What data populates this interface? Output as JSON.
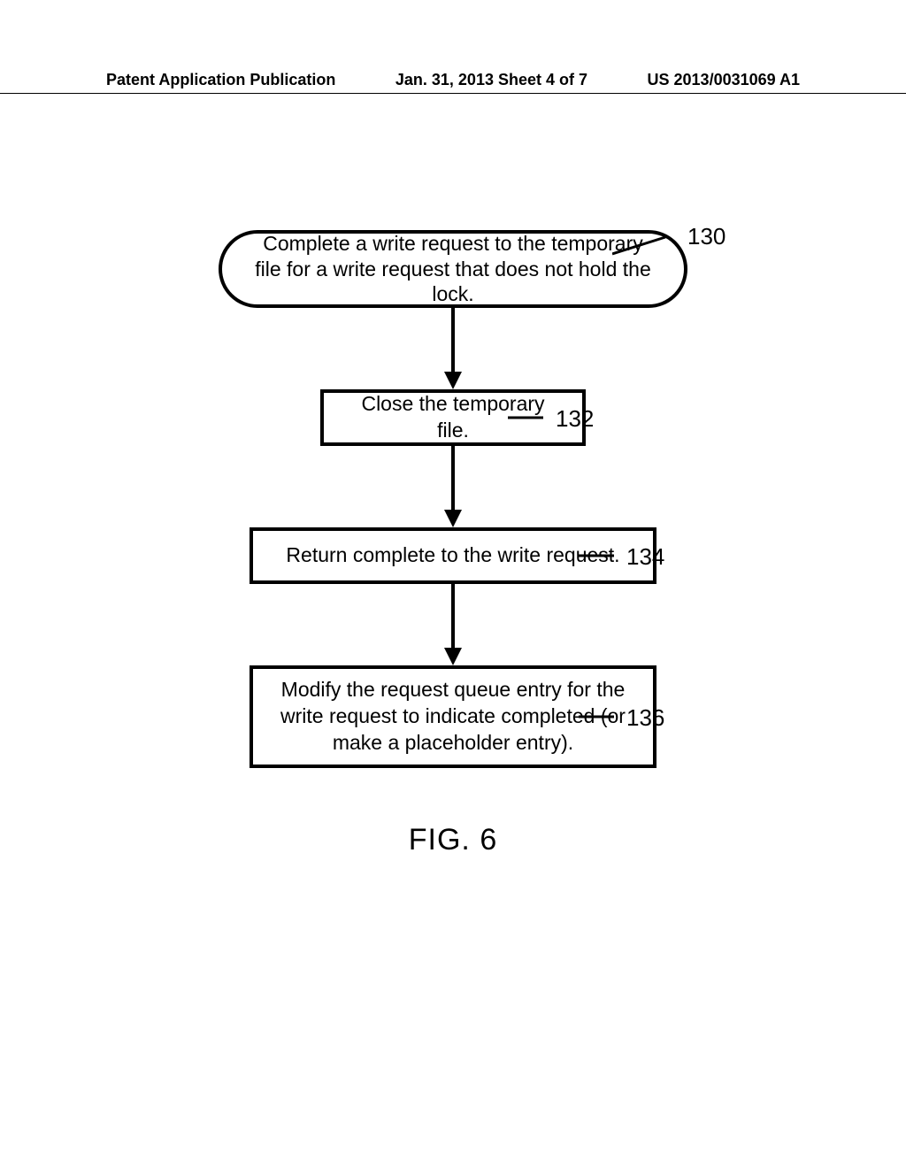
{
  "header": {
    "left": "Patent Application Publication",
    "center": "Jan. 31, 2013  Sheet 4 of 7",
    "right": "US 2013/0031069 A1"
  },
  "chart_data": {
    "type": "flowchart",
    "title": "FIG. 6",
    "nodes": [
      {
        "id": "n130",
        "shape": "terminator",
        "label": "130",
        "text": "Complete a write request to the temporary file for a write request that does not hold the lock."
      },
      {
        "id": "n132",
        "shape": "process",
        "label": "132",
        "text": "Close the temporary file."
      },
      {
        "id": "n134",
        "shape": "process",
        "label": "134",
        "text": "Return complete to the write request."
      },
      {
        "id": "n136",
        "shape": "process",
        "label": "136",
        "text": "Modify the request queue entry for the write request to indicate completed (or make a placeholder entry)."
      }
    ],
    "edges": [
      {
        "from": "n130",
        "to": "n132"
      },
      {
        "from": "n132",
        "to": "n134"
      },
      {
        "from": "n134",
        "to": "n136"
      }
    ]
  }
}
